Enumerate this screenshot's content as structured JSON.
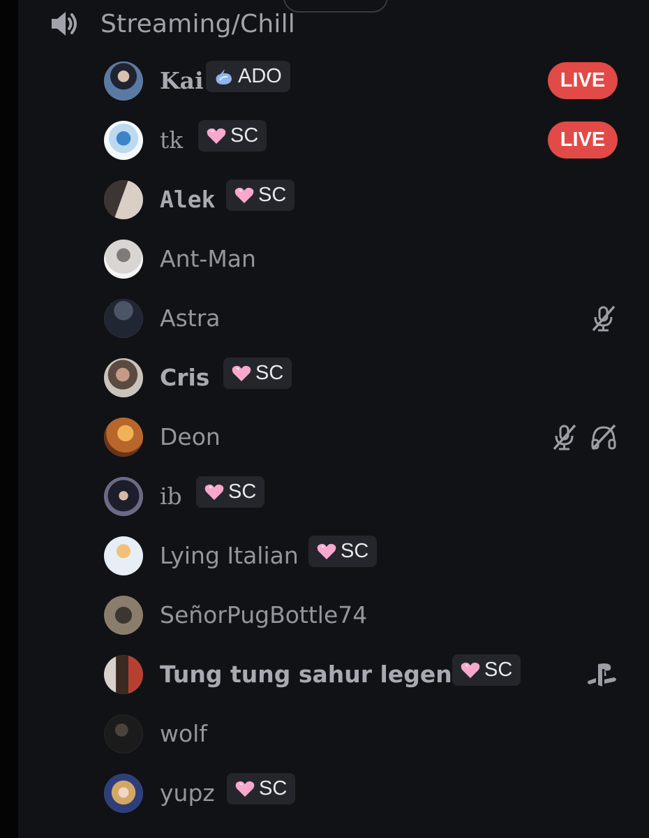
{
  "channel": {
    "name": "Streaming/Chill",
    "icon": "speaker-icon"
  },
  "colors": {
    "live": "#e14a46",
    "background": "#111215",
    "username": "#93969d",
    "tag_bg": "#25262c"
  },
  "users": [
    {
      "name": "Kai",
      "tag": "ADO",
      "tag_icon": "blue-crystal-icon",
      "live": "LIVE"
    },
    {
      "name": "tk",
      "tag": "SC",
      "tag_icon": "pink-heart-icon",
      "live": "LIVE"
    },
    {
      "name": "Alek",
      "tag": "SC",
      "tag_icon": "pink-heart-icon"
    },
    {
      "name": "Ant-Man"
    },
    {
      "name": "Astra",
      "status": [
        "muted-mic-icon"
      ]
    },
    {
      "name": "Cris",
      "tag": "SC",
      "tag_icon": "pink-heart-icon"
    },
    {
      "name": "Deon",
      "status": [
        "muted-mic-icon",
        "deafened-headphones-icon"
      ]
    },
    {
      "name": "ib",
      "tag": "SC",
      "tag_icon": "pink-heart-icon"
    },
    {
      "name": "Lying Italian",
      "tag": "SC",
      "tag_icon": "pink-heart-icon"
    },
    {
      "name": "SeñorPugBottle74"
    },
    {
      "name": "Tung tung sahur legend",
      "tag": "SC",
      "tag_icon": "pink-heart-icon",
      "status": [
        "playstation-icon"
      ]
    },
    {
      "name": "wolf"
    },
    {
      "name": "yupz",
      "tag": "SC",
      "tag_icon": "pink-heart-icon"
    }
  ]
}
